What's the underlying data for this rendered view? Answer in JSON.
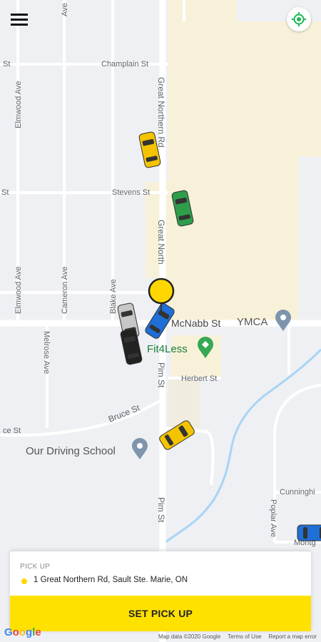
{
  "map": {
    "streets": {
      "champlain": "Champlain St",
      "champlain_left": "St",
      "stevens": "Stevens St",
      "stevens_left": "St",
      "great_northern_top": "Great Northern Rd",
      "great_northern_mid": "Great North",
      "elmwood_top": "Elmwood Ave",
      "elmwood_bottom": "Elmwood Ave",
      "cameron": "Cameron Ave",
      "blake": "Blake Ave",
      "mcnabb": "McNabb St",
      "melrose": "Melrose Ave",
      "pim_top": "Pim St",
      "pim_bottom": "Pim St",
      "herbert": "Herbert St",
      "bruce": "Bruce St",
      "bruce_left": "ce St",
      "cunningham": "Cunninghi",
      "poplar": "Poplar Ave",
      "montgomery": "Montg"
    },
    "pois": {
      "ymca": "YMCA",
      "fit4less": "Fit4Less",
      "driving_school": "Our Driving School"
    },
    "cars": [
      {
        "color": "#f4c300"
      },
      {
        "color": "#2e9e4a"
      },
      {
        "color": "#c7c7c7"
      },
      {
        "color": "#1f6fd6"
      },
      {
        "color": "#222222"
      },
      {
        "color": "#f4c300"
      },
      {
        "color": "#1f6fd6"
      }
    ]
  },
  "pickup": {
    "heading": "PICK UP",
    "address": "1 Great Northern Rd, Sault Ste. Marie, ON",
    "button_label": "SET PICK UP"
  },
  "footer": {
    "logo": "Google",
    "map_data": "Map data ©2020 Google",
    "terms": "Terms of Use",
    "report": "Report a map error"
  },
  "colors": {
    "accent": "#ffe100",
    "pin": "#ffd700",
    "map_bg": "#eef0f3",
    "building": "#f8f1d9",
    "water": "#a8d4f5"
  },
  "icons": {
    "menu": "hamburger-menu-icon",
    "locate": "gps-target-icon",
    "pickup_pin": "pickup-pin-icon"
  }
}
